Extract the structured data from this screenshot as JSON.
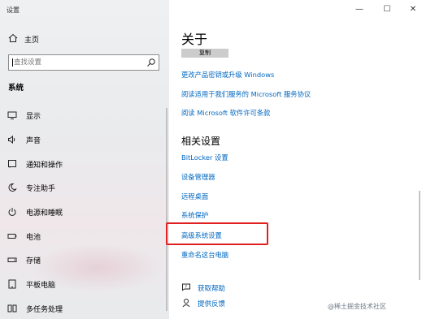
{
  "window": {
    "title": "设置",
    "controls": {
      "minimize": "—",
      "maximize": "☐",
      "close": "✕"
    }
  },
  "sidebar": {
    "home_label": "主页",
    "search_placeholder": "查找设置",
    "section_label": "系统",
    "items": [
      {
        "label": "显示",
        "icon": "monitor-icon"
      },
      {
        "label": "声音",
        "icon": "speaker-icon"
      },
      {
        "label": "通知和操作",
        "icon": "notification-icon"
      },
      {
        "label": "专注助手",
        "icon": "moon-icon"
      },
      {
        "label": "电源和睡眠",
        "icon": "power-icon"
      },
      {
        "label": "电池",
        "icon": "battery-icon"
      },
      {
        "label": "存储",
        "icon": "storage-icon"
      },
      {
        "label": "平板电脑",
        "icon": "tablet-icon"
      },
      {
        "label": "多任务处理",
        "icon": "multitask-icon"
      }
    ]
  },
  "main": {
    "heading": "关于",
    "copy_button": "复制",
    "links": [
      "更改产品密钥或升级 Windows",
      "阅读适用于我们服务的 Microsoft 服务协议",
      "阅读 Microsoft 软件许可条款"
    ],
    "related_heading": "相关设置",
    "related_links": [
      "BitLocker 设置",
      "设备管理器",
      "远程桌面",
      "系统保护",
      "高级系统设置",
      "重命名这台电脑"
    ],
    "help": [
      {
        "label": "获取帮助",
        "icon": "help-icon"
      },
      {
        "label": "提供反馈",
        "icon": "feedback-icon"
      }
    ]
  },
  "watermark": "@稀土掘金技术社区",
  "colors": {
    "link": "#0067c0",
    "highlight_box": "#e02020",
    "sidebar_bg": "#eceef0"
  }
}
